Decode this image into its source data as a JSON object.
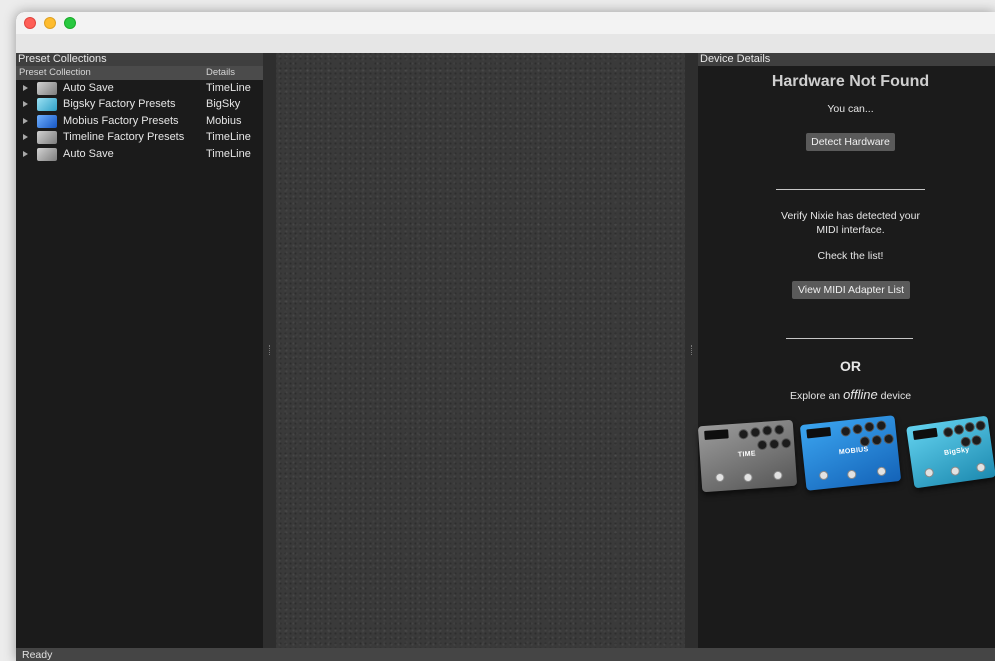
{
  "window": {
    "title": ""
  },
  "left_panel": {
    "title": "Preset Collections",
    "columns": {
      "collection": "Preset Collection",
      "details": "Details"
    },
    "rows": [
      {
        "name": "Auto Save",
        "details": "TimeLine",
        "thumb": "timeline-pedal-thumbnail"
      },
      {
        "name": "Bigsky Factory Presets",
        "details": "BigSky",
        "thumb": "bigsky-pedal-thumbnail"
      },
      {
        "name": "Mobius Factory Presets",
        "details": "Mobius",
        "thumb": "mobius-pedal-thumbnail"
      },
      {
        "name": "Timeline Factory Presets",
        "details": "TimeLine",
        "thumb": "timeline-pedal-thumbnail"
      },
      {
        "name": "Auto Save",
        "details": "TimeLine",
        "thumb": "timeline-pedal-thumbnail"
      }
    ]
  },
  "right_panel": {
    "title": "Device Details",
    "heading": "Hardware Not Found",
    "you_can": "You can...",
    "detect_button": "Detect Hardware",
    "verify_line1": "Verify Nixie has detected your",
    "verify_line2": "MIDI interface.",
    "check_list": "Check the list!",
    "midi_list_button": "View MIDI Adapter List",
    "or": "OR",
    "explore_prefix": "Explore an ",
    "explore_offline": "offline",
    "explore_suffix": " device",
    "pedals": [
      {
        "label": "TIME",
        "icon": "timeline-pedal-image"
      },
      {
        "label": "MOBIUS",
        "icon": "mobius-pedal-image"
      },
      {
        "label": "BigSky",
        "icon": "bigsky-pedal-image"
      }
    ]
  },
  "status": {
    "text": "Ready"
  },
  "colors": {
    "panel_bg": "#1b1b1b",
    "header_bg": "#3f3f3f",
    "button_bg": "#5a5a5a",
    "mobius_blue": "#2a86e0",
    "bigsky_cyan": "#3fb6dc"
  }
}
